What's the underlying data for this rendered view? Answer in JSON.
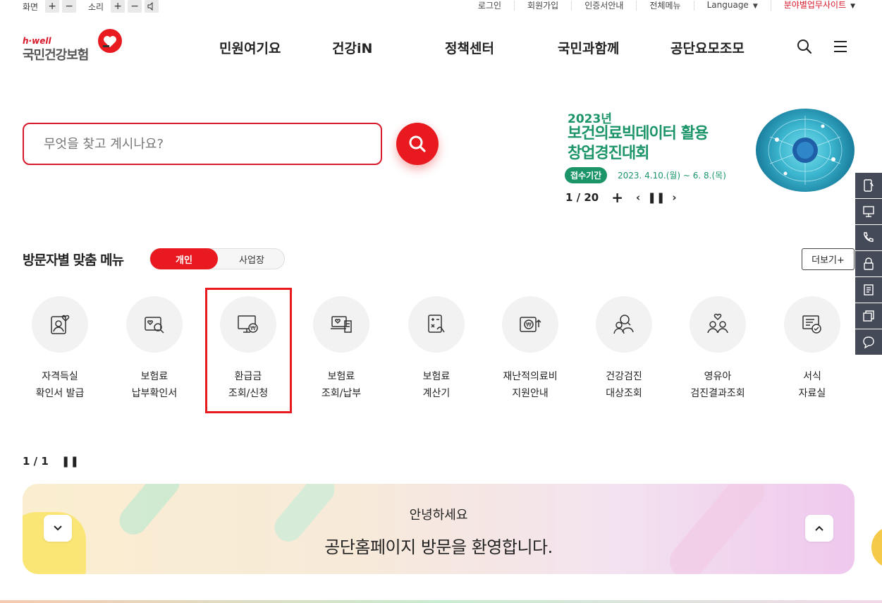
{
  "utility": {
    "screen_label": "화면",
    "sound_label": "소리",
    "plus": "+",
    "minus": "−",
    "links": [
      "로그인",
      "회원가입",
      "인증서안내",
      "전체메뉴",
      "Language",
      "분야별업무사이트"
    ]
  },
  "logo": {
    "brand": "h·well",
    "name": "국민건강보험"
  },
  "gnb": [
    "민원여기요",
    "건강iN",
    "정책센터",
    "국민과함께",
    "공단요모조모"
  ],
  "search": {
    "placeholder": "무엇을 찾고 계시나요?"
  },
  "banner": {
    "year": "2023년",
    "title_line1": "보건의료빅데이터 활용",
    "title_line2": "창업경진대회",
    "pill": "접수기간",
    "date": "2023. 4.10.(월) ~ 6. 8.(목)",
    "pager": "1 / 20"
  },
  "visitor_menu": {
    "title": "방문자별 맞춤 메뉴",
    "tab_personal": "개인",
    "tab_business": "사업장",
    "more": "더보기+",
    "items": [
      {
        "line1": "자격득실",
        "line2": "확인서 발급",
        "icon": "person-card-icon"
      },
      {
        "line1": "보험료",
        "line2": "납부확인서",
        "icon": "search-document-icon"
      },
      {
        "line1": "환급금",
        "line2": "조회/신청",
        "icon": "monitor-won-icon"
      },
      {
        "line1": "보험료",
        "line2": "조회/납부",
        "icon": "laptop-receipt-icon"
      },
      {
        "line1": "보험료",
        "line2": "계산기",
        "icon": "calculator-icon"
      },
      {
        "line1": "재난적의료비",
        "line2": "지원안내",
        "icon": "wallet-won-icon"
      },
      {
        "line1": "건강검진",
        "line2": "대상조회",
        "icon": "people-search-icon"
      },
      {
        "line1": "영유아",
        "line2": "검진결과조회",
        "icon": "family-heart-icon"
      },
      {
        "line1": "서식",
        "line2": "자료실",
        "icon": "form-check-icon"
      }
    ],
    "pager": "1 / 1"
  },
  "welcome": {
    "hello": "안녕하세요",
    "message": "공단홈페이지 방문을 환영합니다."
  },
  "colors": {
    "accent": "#e8191f",
    "banner_green": "#1b9468",
    "quick_bar": "#444a57"
  }
}
